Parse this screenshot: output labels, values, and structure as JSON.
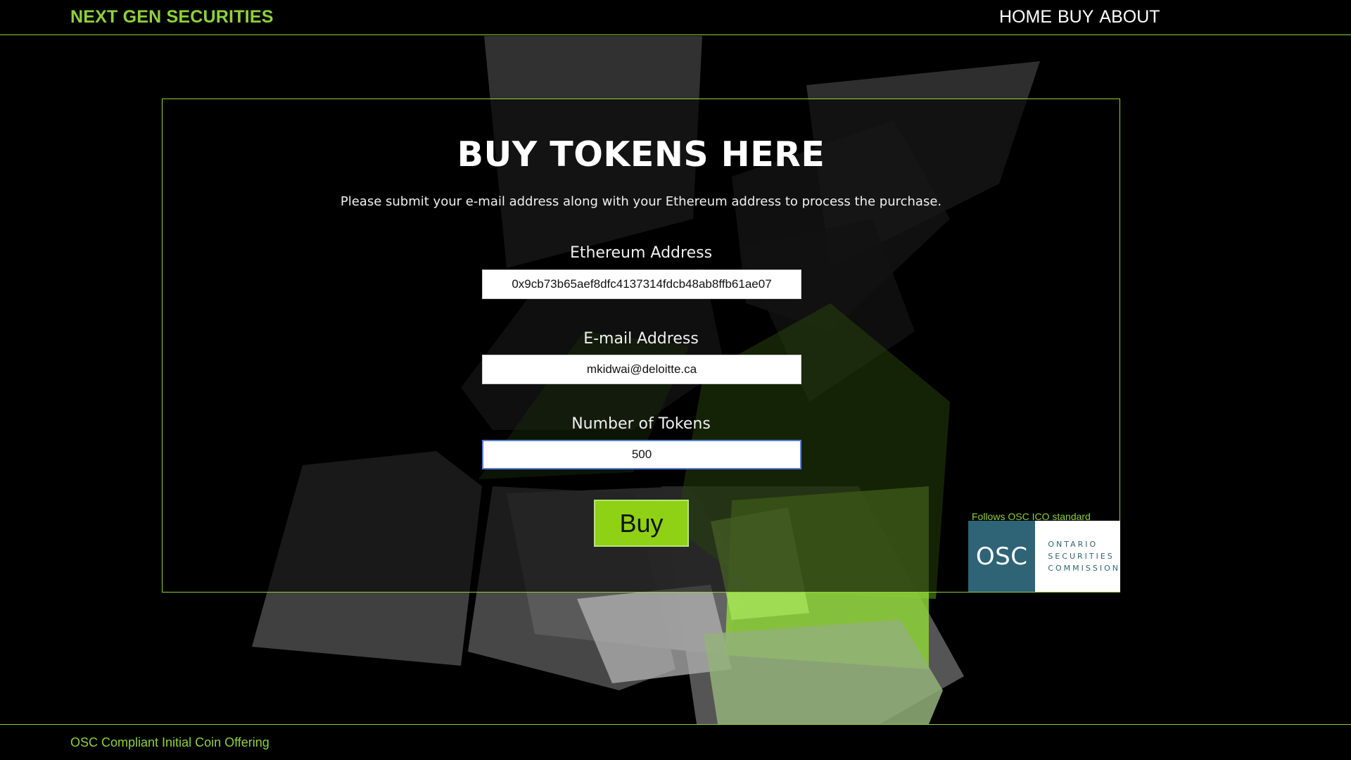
{
  "header": {
    "brand": "NEXT GEN SECURITIES",
    "nav": {
      "home": "HOME",
      "buy": "BUY",
      "about": "ABOUT"
    }
  },
  "form": {
    "title": "BUY TOKENS HERE",
    "subtitle": "Please submit your e-mail address along with your Ethereum address to process the purchase.",
    "eth_label": "Ethereum Address",
    "eth_value": "0x9cb73b65aef8dfc4137314fdcb48ab8ffb61ae07",
    "email_label": "E-mail Address",
    "email_value": "mkidwai@deloitte.ca",
    "tokens_label": "Number of Tokens",
    "tokens_value": "500",
    "buy_label": "Buy"
  },
  "osc": {
    "note": "Follows OSC ICO standard",
    "logo_abbr": "OSC",
    "logo_line1": "ONTARIO",
    "logo_line2": "SECURITIES",
    "logo_line3": "COMMISSION"
  },
  "footer": {
    "text": "OSC Compliant Initial Coin Offering"
  },
  "colors": {
    "accent": "#8fd13a",
    "button": "#8fd114",
    "osc_blue": "#2f6376",
    "background": "#000000"
  }
}
